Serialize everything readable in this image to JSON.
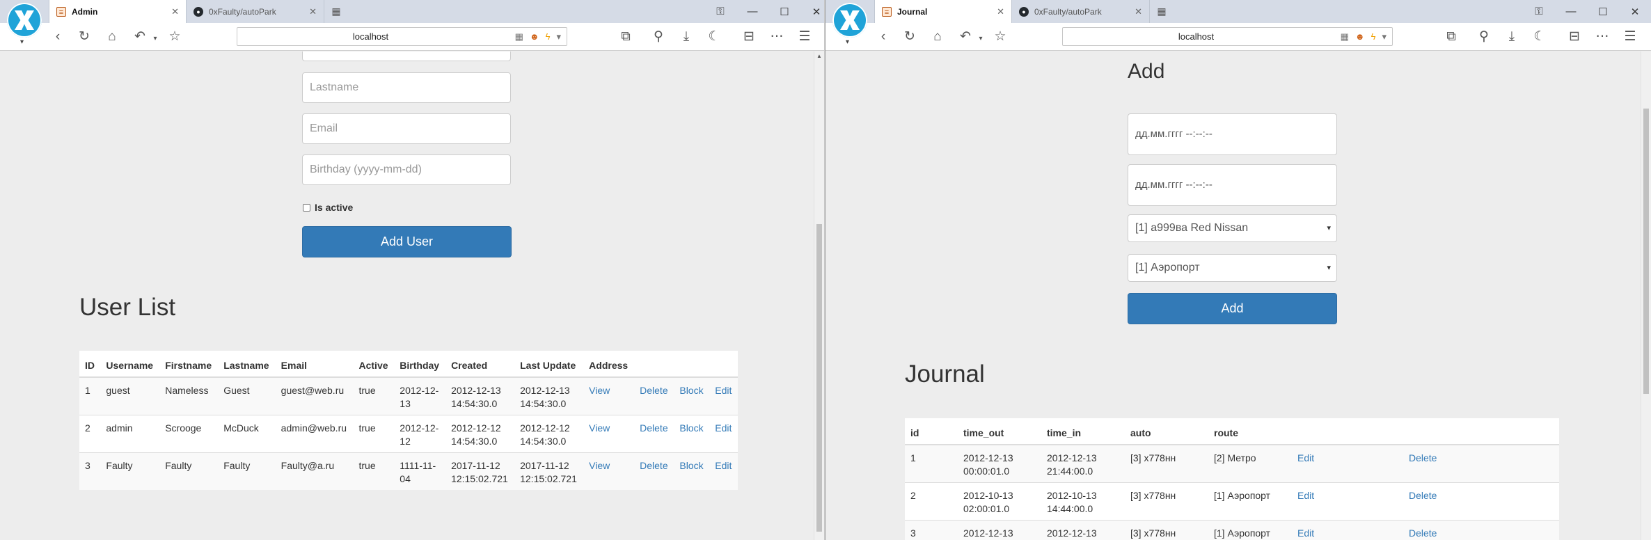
{
  "left_window": {
    "tabs": [
      {
        "title": "Admin",
        "icon": "page-icon"
      },
      {
        "title": "0xFaulty/autoPark",
        "icon": "github-icon"
      }
    ],
    "address": "localhost",
    "form": {
      "lastname_placeholder": "Lastname",
      "email_placeholder": "Email",
      "birthday_placeholder": "Birthday (yyyy-mm-dd)",
      "is_active_label": "Is active",
      "add_user_button": "Add User"
    },
    "user_list": {
      "heading": "User List",
      "columns": [
        "ID",
        "Username",
        "Firstname",
        "Lastname",
        "Email",
        "Active",
        "Birthday",
        "Created",
        "Last Update",
        "Address"
      ],
      "rows": [
        {
          "id": "1",
          "username": "guest",
          "firstname": "Nameless",
          "lastname": "Guest",
          "email": "guest@web.ru",
          "active": "true",
          "birthday_1": "2012-12-",
          "birthday_2": "13",
          "created_1": "2012-12-13",
          "created_2": "14:54:30.0",
          "updated_1": "2012-12-13",
          "updated_2": "14:54:30.0",
          "view": "View",
          "delete": "Delete",
          "block": "Block",
          "edit": "Edit"
        },
        {
          "id": "2",
          "username": "admin",
          "firstname": "Scrooge",
          "lastname": "McDuck",
          "email": "admin@web.ru",
          "active": "true",
          "birthday_1": "2012-12-",
          "birthday_2": "12",
          "created_1": "2012-12-12",
          "created_2": "14:54:30.0",
          "updated_1": "2012-12-12",
          "updated_2": "14:54:30.0",
          "view": "View",
          "delete": "Delete",
          "block": "Block",
          "edit": "Edit"
        },
        {
          "id": "3",
          "username": "Faulty",
          "firstname": "Faulty",
          "lastname": "Faulty",
          "email": "Faulty@a.ru",
          "active": "true",
          "birthday_1": "1111-11-",
          "birthday_2": "04",
          "created_1": "2017-11-12",
          "created_2": "12:15:02.721",
          "updated_1": "2017-11-12",
          "updated_2": "12:15:02.721",
          "view": "View",
          "delete": "Delete",
          "block": "Block",
          "edit": "Edit"
        }
      ]
    }
  },
  "right_window": {
    "tabs": [
      {
        "title": "Journal",
        "icon": "page-icon"
      },
      {
        "title": "0xFaulty/autoPark",
        "icon": "github-icon"
      }
    ],
    "address": "localhost",
    "add_form": {
      "heading": "Add",
      "time_out_value": "дд.мм.гггг  --:--:--",
      "time_in_value": "дд.мм.гггг  --:--:--",
      "auto_selected": "[1] а999ва Red Nissan",
      "route_selected": "[1] Аэропорт",
      "add_button": "Add"
    },
    "journal": {
      "heading": "Journal",
      "columns": [
        "id",
        "time_out",
        "time_in",
        "auto",
        "route"
      ],
      "rows": [
        {
          "id": "1",
          "out_1": "2012-12-13",
          "out_2": "00:00:01.0",
          "in_1": "2012-12-13",
          "in_2": "21:44:00.0",
          "auto": "[3] х778нн",
          "route": "[2] Метро",
          "edit": "Edit",
          "delete": "Delete"
        },
        {
          "id": "2",
          "out_1": "2012-10-13",
          "out_2": "02:00:01.0",
          "in_1": "2012-10-13",
          "in_2": "14:44:00.0",
          "auto": "[3] х778нн",
          "route": "[1] Аэропорт",
          "edit": "Edit",
          "delete": "Delete"
        },
        {
          "id": "3",
          "out_1": "2012-12-13",
          "out_2": "",
          "in_1": "2012-12-13",
          "in_2": "",
          "auto": "[3] х778нн",
          "route": "[1] Аэропорт",
          "edit": "Edit",
          "delete": "Delete"
        }
      ]
    }
  },
  "colors": {
    "primary_button": "#337ab7",
    "link": "#337ab7",
    "page_background": "#ededed",
    "tabstrip": "#d5dbe6"
  }
}
